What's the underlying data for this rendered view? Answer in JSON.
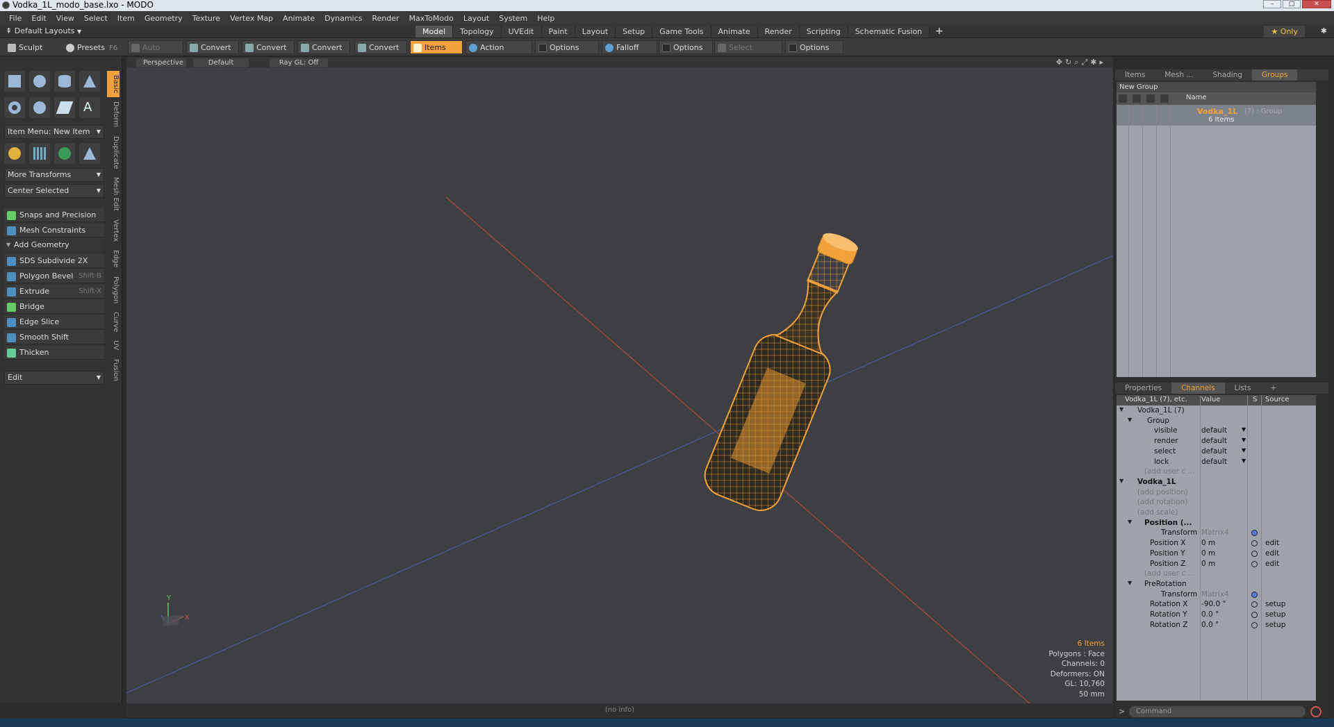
{
  "window": {
    "title": "Vodka_1L_modo_base.lxo - MODO"
  },
  "menu": [
    "File",
    "Edit",
    "View",
    "Select",
    "Item",
    "Geometry",
    "Texture",
    "Vertex Map",
    "Animate",
    "Dynamics",
    "Render",
    "MaxToModo",
    "Layout",
    "System",
    "Help"
  ],
  "layout": {
    "selector": "Default Layouts",
    "tabs": [
      "Model",
      "Topology",
      "UVEdit",
      "Paint",
      "Layout",
      "Setup",
      "Game Tools",
      "Animate",
      "Render",
      "Scripting",
      "Schematic Fusion"
    ],
    "active_tab": "Model",
    "only_label": "Only"
  },
  "toolbar": {
    "sculpt": "Sculpt",
    "presets": "Presets",
    "presets_key": "F6",
    "auto_select": "Auto Select",
    "convert1": "Convert",
    "convert2": "Convert",
    "convert3": "Convert",
    "convert4": "Convert",
    "items": "Items",
    "action_center": "Action Center",
    "options1": "Options",
    "falloff": "Falloff",
    "options2": "Options",
    "select_through": "Select Through",
    "options3": "Options"
  },
  "left": {
    "vtabs": [
      "Basic",
      "Deform",
      "Duplicate",
      "Mesh Edit",
      "Vertex",
      "Edge",
      "Polygon",
      "Curve",
      "UV",
      "Fusion"
    ],
    "item_menu": "Item Menu: New Item",
    "more_transforms": "More Transforms",
    "center_selected": "Center Selected",
    "snaps": "Snaps and Precision",
    "mesh_constraints": "Mesh Constraints",
    "add_geometry": "Add Geometry",
    "tools": [
      {
        "label": "SDS Subdivide 2X",
        "key": ""
      },
      {
        "label": "Polygon Bevel",
        "key": "Shift-B"
      },
      {
        "label": "Extrude",
        "key": "Shift-X"
      },
      {
        "label": "Bridge",
        "key": ""
      },
      {
        "label": "Edge Slice",
        "key": ""
      },
      {
        "label": "Smooth Shift",
        "key": ""
      },
      {
        "label": "Thicken",
        "key": ""
      }
    ],
    "edit": "Edit"
  },
  "viewport": {
    "view": "Perspective",
    "shading": "Default",
    "raygl": "Ray GL: Off",
    "info": {
      "items": "6 Items",
      "polygons": "Polygons : Face",
      "channels": "Channels: 0",
      "deformers": "Deformers: ON",
      "gl": "GL: 10,760",
      "lens": "50 mm"
    },
    "status": "(no info)"
  },
  "groups_panel": {
    "tabs": [
      "Items",
      "Mesh ...",
      "Shading",
      "Groups"
    ],
    "active_tab": "Groups",
    "new_group": "New Group",
    "col_name": "Name",
    "group_name": "Vodka_1L",
    "group_meta": "(7) : Group",
    "group_count": "6 Items"
  },
  "channels_panel": {
    "tabs": [
      "Properties",
      "Channels",
      "Lists"
    ],
    "active_tab": "Channels",
    "header_name": "Vodka_1L (7), etc.",
    "header_value": "Value",
    "header_s": "S",
    "header_source": "Source",
    "rows": [
      {
        "label": "Vodka_1L (7)",
        "value": "",
        "source": ""
      },
      {
        "label": "Group",
        "value": "",
        "source": ""
      },
      {
        "label": "visible",
        "value": "default",
        "source": ""
      },
      {
        "label": "render",
        "value": "default",
        "source": ""
      },
      {
        "label": "select",
        "value": "default",
        "source": ""
      },
      {
        "label": "lock",
        "value": "default",
        "source": ""
      },
      {
        "label": "(add user c ...",
        "value": "",
        "source": ""
      },
      {
        "label": "Vodka_1L",
        "value": "",
        "source": ""
      },
      {
        "label": "(add position)",
        "value": "",
        "source": ""
      },
      {
        "label": "(add rotation)",
        "value": "",
        "source": ""
      },
      {
        "label": "(add scale)",
        "value": "",
        "source": ""
      },
      {
        "label": "Position (...",
        "value": "",
        "source": ""
      },
      {
        "label": "Transform",
        "value": "Matrix4",
        "source": ""
      },
      {
        "label": "Position X",
        "value": "0 m",
        "source": "edit"
      },
      {
        "label": "Position Y",
        "value": "0 m",
        "source": "edit"
      },
      {
        "label": "Position Z",
        "value": "0 m",
        "source": "edit"
      },
      {
        "label": "(add user c ...",
        "value": "",
        "source": ""
      },
      {
        "label": "PreRotation",
        "value": "",
        "source": ""
      },
      {
        "label": "Transform",
        "value": "Matrix4",
        "source": ""
      },
      {
        "label": "Rotation X",
        "value": "-90.0 °",
        "source": "setup"
      },
      {
        "label": "Rotation Y",
        "value": "0.0 °",
        "source": "setup"
      },
      {
        "label": "Rotation Z",
        "value": "0.0 °",
        "source": "setup"
      }
    ]
  },
  "command": {
    "placeholder": "Command"
  },
  "colors": {
    "accent": "#f2a23c",
    "wire": "#f2a23c"
  }
}
